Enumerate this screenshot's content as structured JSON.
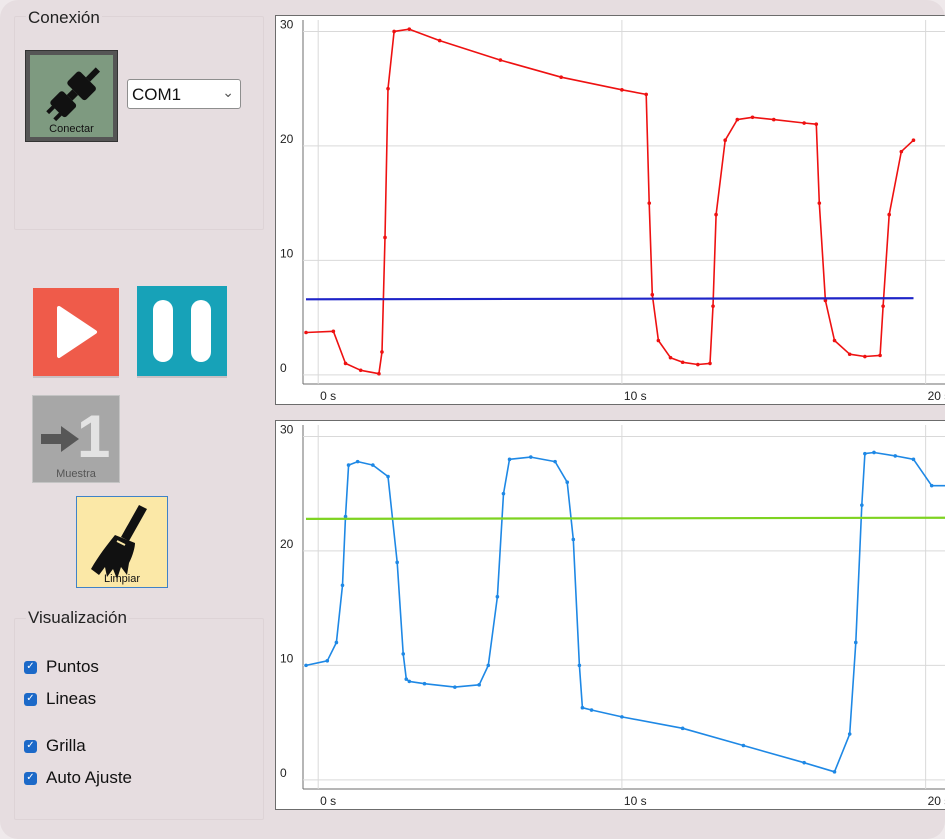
{
  "connection": {
    "group_label": "Conexión",
    "connect_label": "Conectar",
    "port": "COM1"
  },
  "controls": {
    "play_icon": "play-icon",
    "pause_icon": "pause-icon",
    "sample_label": "Muestra",
    "sample_number": "1",
    "clear_label": "Limpiar"
  },
  "visualization": {
    "group_label": "Visualización",
    "options": [
      {
        "label": "Puntos",
        "checked": true
      },
      {
        "label": "Lineas",
        "checked": true
      },
      {
        "label": "Grilla",
        "checked": true
      },
      {
        "label": "Auto Ajuste",
        "checked": true
      }
    ]
  },
  "colors": {
    "play": "#ef5b4a",
    "pause": "#17a2b8",
    "clear": "#fbe8a7",
    "checkbox": "#1c69c8"
  },
  "chart_data": [
    {
      "type": "line",
      "xlim": [
        -0.5,
        21
      ],
      "ylim": [
        -0.8,
        31
      ],
      "x_ticks": [
        "0 s",
        "10 s",
        "20 s"
      ],
      "x_tick_values": [
        0,
        10,
        20
      ],
      "y_ticks": [
        "0",
        "10",
        "20",
        "30"
      ],
      "y_tick_values": [
        0,
        10,
        20,
        30
      ],
      "grid": true,
      "series": [
        {
          "color": "#ee1111",
          "x": [
            -0.4,
            0.5,
            0.9,
            1.4,
            2.0,
            2.1,
            2.2,
            2.3,
            2.5,
            3.0,
            4.0,
            6.0,
            8.0,
            10.0,
            10.8,
            10.9,
            11.0,
            11.2,
            11.6,
            12.0,
            12.5,
            12.9,
            13.0,
            13.1,
            13.4,
            13.8,
            14.3,
            15.0,
            16.0,
            16.4,
            16.5,
            16.7,
            17.0,
            17.5,
            18.0,
            18.5,
            18.6,
            18.8,
            19.2,
            19.6
          ],
          "y": [
            3.7,
            3.8,
            1.0,
            0.4,
            0.1,
            2.0,
            12.0,
            25.0,
            30.0,
            30.2,
            29.2,
            27.5,
            26.0,
            24.9,
            24.5,
            15.0,
            7.0,
            3.0,
            1.5,
            1.1,
            0.9,
            1.0,
            6.0,
            14.0,
            20.5,
            22.3,
            22.5,
            22.3,
            22.0,
            21.9,
            15.0,
            6.5,
            3.0,
            1.8,
            1.6,
            1.7,
            6.0,
            14.0,
            19.5,
            20.5
          ]
        },
        {
          "color": "#1e24c8",
          "x": [
            -0.4,
            19.6
          ],
          "y": [
            6.6,
            6.7
          ]
        }
      ]
    },
    {
      "type": "line",
      "xlim": [
        -0.5,
        21
      ],
      "ylim": [
        -0.8,
        31
      ],
      "x_ticks": [
        "0 s",
        "10 s",
        "20 s"
      ],
      "x_tick_values": [
        0,
        10,
        20
      ],
      "y_ticks": [
        "0",
        "10",
        "20",
        "30"
      ],
      "y_tick_values": [
        0,
        10,
        20,
        30
      ],
      "grid": true,
      "series": [
        {
          "color": "#1e88e5",
          "x": [
            -0.4,
            0.3,
            0.6,
            0.8,
            0.9,
            1.0,
            1.3,
            1.8,
            2.3,
            2.6,
            2.8,
            2.9,
            3.0,
            3.5,
            4.5,
            5.3,
            5.6,
            5.9,
            6.1,
            6.3,
            7.0,
            7.8,
            8.2,
            8.4,
            8.6,
            8.7,
            9.0,
            10.0,
            12.0,
            14.0,
            16.0,
            17.0,
            17.5,
            17.7,
            17.9,
            18.0,
            18.3,
            19.0,
            19.6,
            20.2,
            21.0
          ],
          "y": [
            10.0,
            10.4,
            12.0,
            17.0,
            23.0,
            27.5,
            27.8,
            27.5,
            26.5,
            19.0,
            11.0,
            8.8,
            8.6,
            8.4,
            8.1,
            8.3,
            10.0,
            16.0,
            25.0,
            28.0,
            28.2,
            27.8,
            26.0,
            21.0,
            10.0,
            6.3,
            6.1,
            5.5,
            4.5,
            3.0,
            1.5,
            0.7,
            4.0,
            12.0,
            24.0,
            28.5,
            28.6,
            28.3,
            28.0,
            25.7,
            25.7
          ]
        },
        {
          "color": "#7ed321",
          "x": [
            -0.4,
            21.0
          ],
          "y": [
            22.8,
            22.9
          ]
        }
      ]
    }
  ]
}
